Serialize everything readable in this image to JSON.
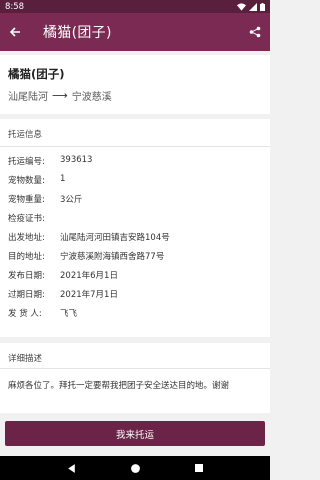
{
  "status_bar": {
    "time": "8:58"
  },
  "app_bar": {
    "title": "橘猫(团子)"
  },
  "header": {
    "pet_name": "橘猫(团子)",
    "route_from": "汕尾陆河",
    "route_to": "宁波慈溪"
  },
  "shipping_info": {
    "section_title": "托运信息",
    "rows": [
      {
        "label": "托运编号:",
        "value": "393613"
      },
      {
        "label": "宠物数量:",
        "value": "1"
      },
      {
        "label": "宠物重量:",
        "value": "3公斤"
      },
      {
        "label": "检疫证书:",
        "value": ""
      },
      {
        "label": "出发地址:",
        "value": "汕尾陆河河田镇吉安路104号"
      },
      {
        "label": "目的地址:",
        "value": "宁波慈溪附海镇西舍路77号"
      },
      {
        "label": "发布日期:",
        "value": "2021年6月1日"
      },
      {
        "label": "过期日期:",
        "value": "2021年7月1日"
      },
      {
        "label": "发 货 人:",
        "value": "飞飞"
      }
    ]
  },
  "description": {
    "section_title": "详细描述",
    "text": "麻烦各位了。拜托一定要帮我把团子安全送达目的地。谢谢"
  },
  "action": {
    "consign_label": "我来托运"
  },
  "colors": {
    "status_bar": "#5b1f3e",
    "app_bar": "#7b2b53",
    "button": "#6b2447"
  },
  "icons": [
    "wifi-icon",
    "signal-icon",
    "battery-icon",
    "back-arrow-icon",
    "share-icon",
    "nav-back-icon",
    "nav-home-icon",
    "nav-recents-icon"
  ]
}
